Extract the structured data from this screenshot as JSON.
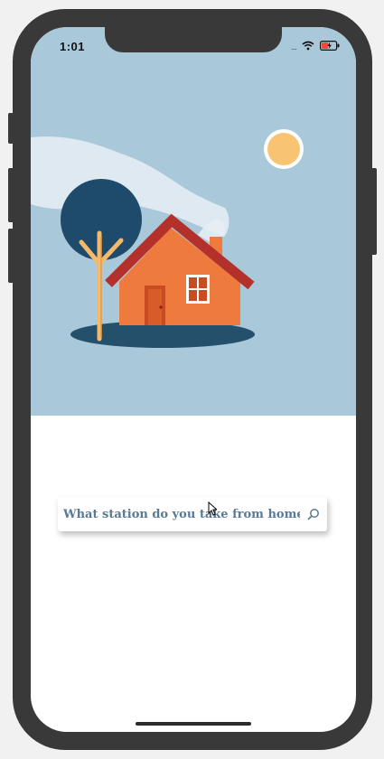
{
  "status_bar": {
    "time": "1:01",
    "signal_dots": "....",
    "wifi_icon": "wifi-icon",
    "battery_icon": "battery-charging-icon"
  },
  "hero": {
    "background_color": "#a9c8da",
    "illustration": "house-with-tree-and-sun"
  },
  "search": {
    "placeholder": "What station do you take from home?",
    "icon": "search-icon",
    "text_color": "#5a7a94"
  },
  "colors": {
    "device_frame": "#393939",
    "house_orange": "#ef7a3e",
    "roof_red": "#c0392b",
    "tree_navy": "#1e4b6b",
    "sun_yellow": "#f8c471"
  }
}
